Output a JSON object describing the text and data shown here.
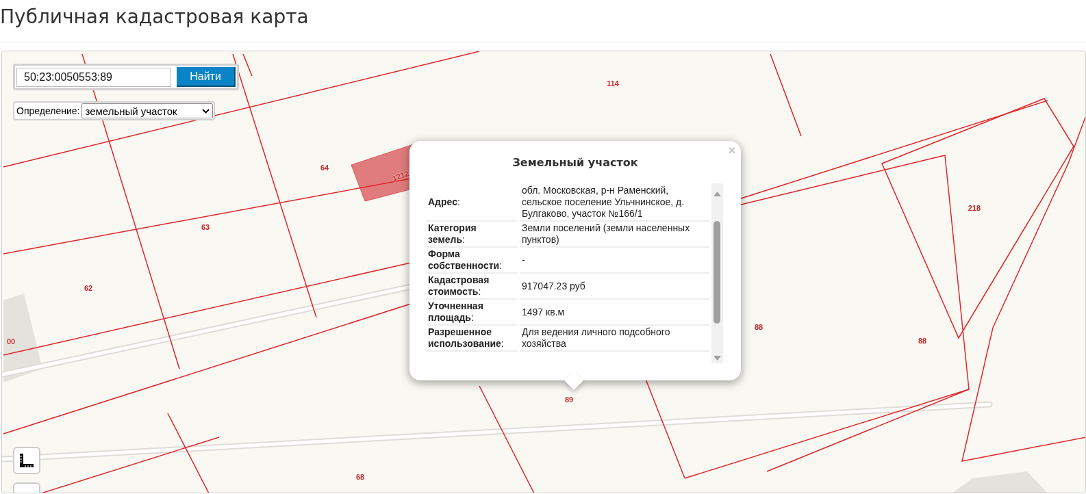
{
  "page_title": "Публичная кадастровая карта",
  "search": {
    "value": "50:23:0050553:89",
    "button": "Найти"
  },
  "definition": {
    "label": "Определение:",
    "value": "земельный участок"
  },
  "map_labels": [
    {
      "text": "114"
    },
    {
      "text": "64"
    },
    {
      "text": "1212"
    },
    {
      "text": "63"
    },
    {
      "text": "62"
    },
    {
      "text": "00"
    },
    {
      "text": "218"
    },
    {
      "text": "88"
    },
    {
      "text": "88"
    },
    {
      "text": "89"
    },
    {
      "text": "68"
    }
  ],
  "popup": {
    "title": "Земельный участок",
    "close": "×",
    "rows": [
      {
        "label": "**Адрес**:",
        "value": "обл. Московская, р-н Раменский, сельское поселение Ульчнинское, д. Булгаково, участок №166/1"
      },
      {
        "label": "**Категория земель**:",
        "value": "Земли поселений (земли населенных пунктов)"
      },
      {
        "label": "**Форма собственности**:",
        "value": "-"
      },
      {
        "label": "**Кадастровая стоимость**:",
        "value": "917047.23 руб"
      },
      {
        "label": "**Уточненная площадь**:",
        "value": "1497 кв.м"
      },
      {
        "label": "**Разрешенное использование**:",
        "value": "Для ведения личного подсобного хозяйства"
      }
    ]
  }
}
